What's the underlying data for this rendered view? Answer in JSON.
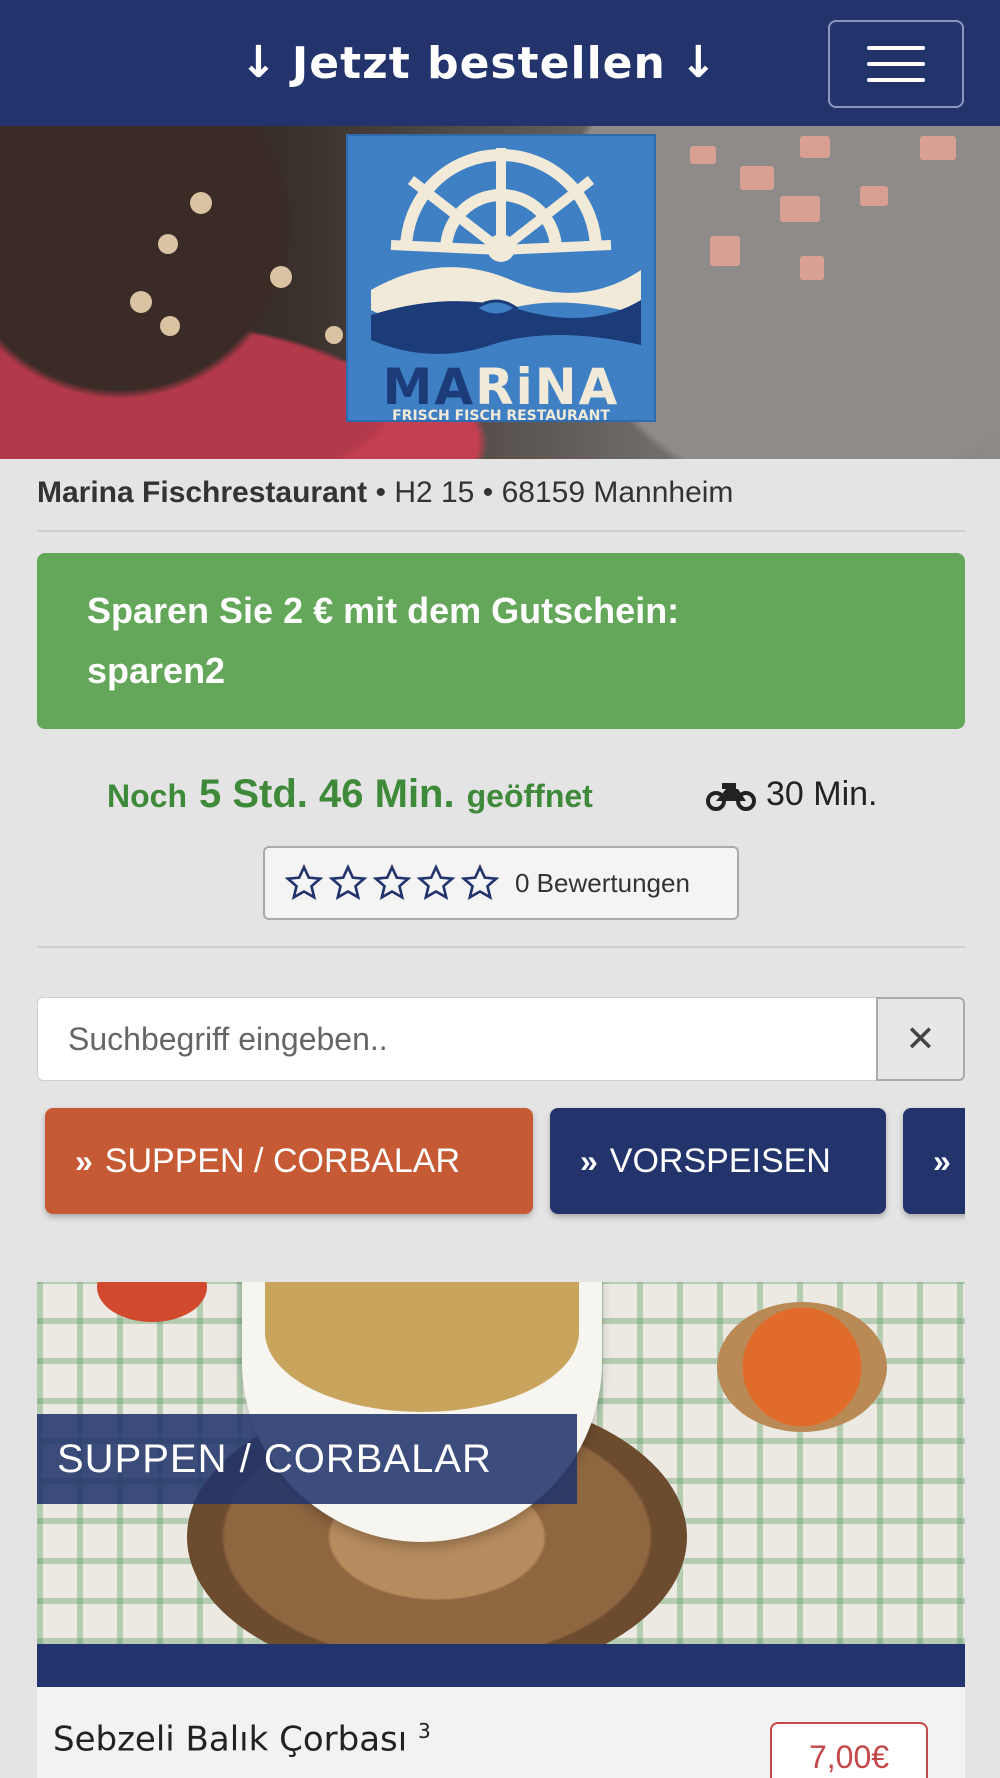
{
  "nav": {
    "order_label": "Jetzt bestellen",
    "arrow_glyph": "↓"
  },
  "logo": {
    "name_part1": "MA",
    "name_part2": "RiNA",
    "subtitle": "FRISCH FISCH RESTAURANT"
  },
  "restaurant": {
    "name": "Marina Fischrestaurant",
    "separator": "•",
    "street": "H2 15",
    "city": "68159 Mannheim"
  },
  "coupon": {
    "text": "Sparen Sie 2 € mit dem Gutschein:",
    "code": "sparen2",
    "color": "#64a65a"
  },
  "opening": {
    "prefix": "Noch",
    "time": "5 Std. 46 Min.",
    "suffix": "geöffnet",
    "delivery_icon": "motorcycle-icon",
    "delivery_time": "30 Min."
  },
  "ratings": {
    "stars_filled": 0,
    "stars_total": 5,
    "count_label": "0 Bewertungen"
  },
  "search": {
    "placeholder": "Suchbegriff eingeben..",
    "value": "",
    "clear_glyph": "✕"
  },
  "categories": [
    {
      "label": "SUPPEN / CORBALAR",
      "active": true
    },
    {
      "label": "VORSPEISEN",
      "active": false
    },
    {
      "label": "",
      "active": false
    }
  ],
  "category_chevron": "»",
  "section": {
    "title": "SUPPEN / CORBALAR"
  },
  "items": [
    {
      "name": "Sebzeli Balık Çorbası",
      "note": "3",
      "price": "7,00€"
    }
  ],
  "colors": {
    "navy": "#22346b",
    "active_category": "#c65a35",
    "open_green": "#3f8a3a",
    "price_red": "#c44848"
  }
}
